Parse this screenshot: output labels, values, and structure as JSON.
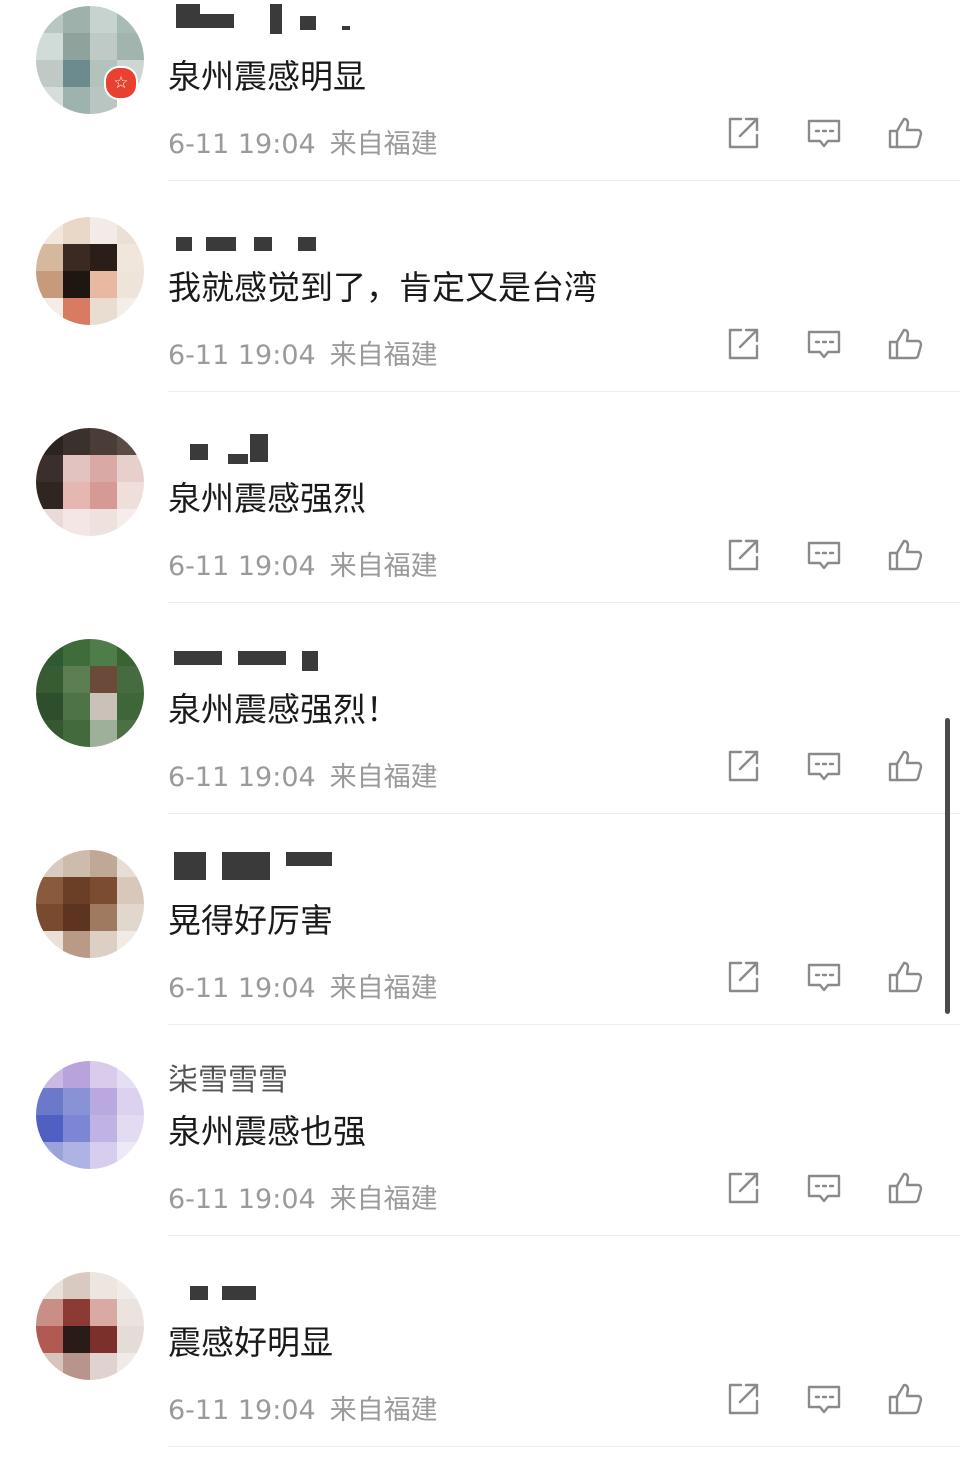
{
  "comments": [
    {
      "username": "",
      "text": "泉州震感明显",
      "time": "6-11 19:04",
      "location": "来自福建",
      "badge": "☆",
      "avatar_colors": [
        "#b9c7c3",
        "#9fb1ab",
        "#c7d3cf",
        "#a8bcb5",
        "#d1dcd8",
        "#8fa39c",
        "#bfcac6",
        "#a1b4ad",
        "#c0c9c5",
        "#6b8b8f",
        "#b4c2be",
        "#ccd6d2",
        "#d6ddda",
        "#9fb3ae",
        "#b8c5c1",
        "#e8412f"
      ]
    },
    {
      "username": "",
      "text": "我就感觉到了，肯定又是台湾",
      "time": "6-11 19:04",
      "location": "来自福建",
      "avatar_colors": [
        "#f1e7de",
        "#e9d7c7",
        "#f3ece6",
        "#ebe0d6",
        "#d6b89f",
        "#3b2a22",
        "#2b1e19",
        "#f0e6dc",
        "#c89a7c",
        "#1f1612",
        "#e8b9a0",
        "#efe4da",
        "#f4ece5",
        "#d97b63",
        "#e9ddd2",
        "#f5eee8"
      ]
    },
    {
      "username": "",
      "text": "泉州震感强烈",
      "time": "6-11 19:04",
      "location": "来自福建",
      "avatar_colors": [
        "#2a2320",
        "#3b312c",
        "#4a3d37",
        "#5a4b44",
        "#3a2f2a",
        "#e2c3bf",
        "#d9a9a5",
        "#e7cfcc",
        "#2f2622",
        "#e6b7b1",
        "#d59a93",
        "#f0dedb",
        "#eadbd8",
        "#f3e6e4",
        "#efe1de",
        "#f6ecea"
      ]
    },
    {
      "username": "",
      "text": "泉州震感强烈！",
      "time": "6-11 19:04",
      "location": "来自福建",
      "avatar_colors": [
        "#2f5a30",
        "#3e6d3b",
        "#4f7d4a",
        "#3a6334",
        "#375c33",
        "#5b7e52",
        "#6b4a3a",
        "#466b40",
        "#2d4f2b",
        "#4d7347",
        "#c9c2b8",
        "#3e6639",
        "#355833",
        "#426a3d",
        "#9fb09a",
        "#4a7044"
      ]
    },
    {
      "username": "",
      "text": "晃得好厉害",
      "time": "6-11 19:04",
      "location": "来自福建",
      "avatar_colors": [
        "#d9cbbf",
        "#cdbbab",
        "#bfa895",
        "#e7ddd4",
        "#8a5a3c",
        "#6b3f25",
        "#7c4c30",
        "#d8c8ba",
        "#7a4a2e",
        "#5c341f",
        "#a07a60",
        "#e2d7cd",
        "#e9e0d8",
        "#b89a86",
        "#dcd0c5",
        "#f1ebe5"
      ]
    },
    {
      "username": "柒雪雪雪",
      "text": "泉州震感也强",
      "time": "6-11 19:04",
      "location": "来自福建",
      "avatar_colors": [
        "#c9b9e3",
        "#b8a3dd",
        "#d8cbec",
        "#e6def3",
        "#6a79c9",
        "#8a92d6",
        "#b9a9e0",
        "#dcd2ef",
        "#4f5fc2",
        "#7d86d2",
        "#c1b2e4",
        "#e3dbf2",
        "#9aa2db",
        "#aeb3e3",
        "#d7cdee",
        "#eee9f7"
      ]
    },
    {
      "username": "",
      "text": "震感好明显",
      "time": "6-11 19:04",
      "location": "来自福建",
      "avatar_colors": [
        "#e9e1dc",
        "#d8c9c1",
        "#ece5e0",
        "#f2ece8",
        "#c98f86",
        "#8b3a34",
        "#d9aaa3",
        "#ebe3de",
        "#b05a52",
        "#2a1b19",
        "#7d2f2b",
        "#e6dcd7",
        "#d8c3bd",
        "#b8948d",
        "#e0d2cc",
        "#f1ebe7"
      ]
    }
  ],
  "icons": {
    "share": "share-icon",
    "reply": "reply-icon",
    "like": "thumbs-up-icon"
  },
  "colors": {
    "text": "#1a1a1a",
    "meta": "#9a9a9a",
    "divider": "#ececec",
    "icon": "#8a8a8a",
    "badge": "#e8412f"
  }
}
